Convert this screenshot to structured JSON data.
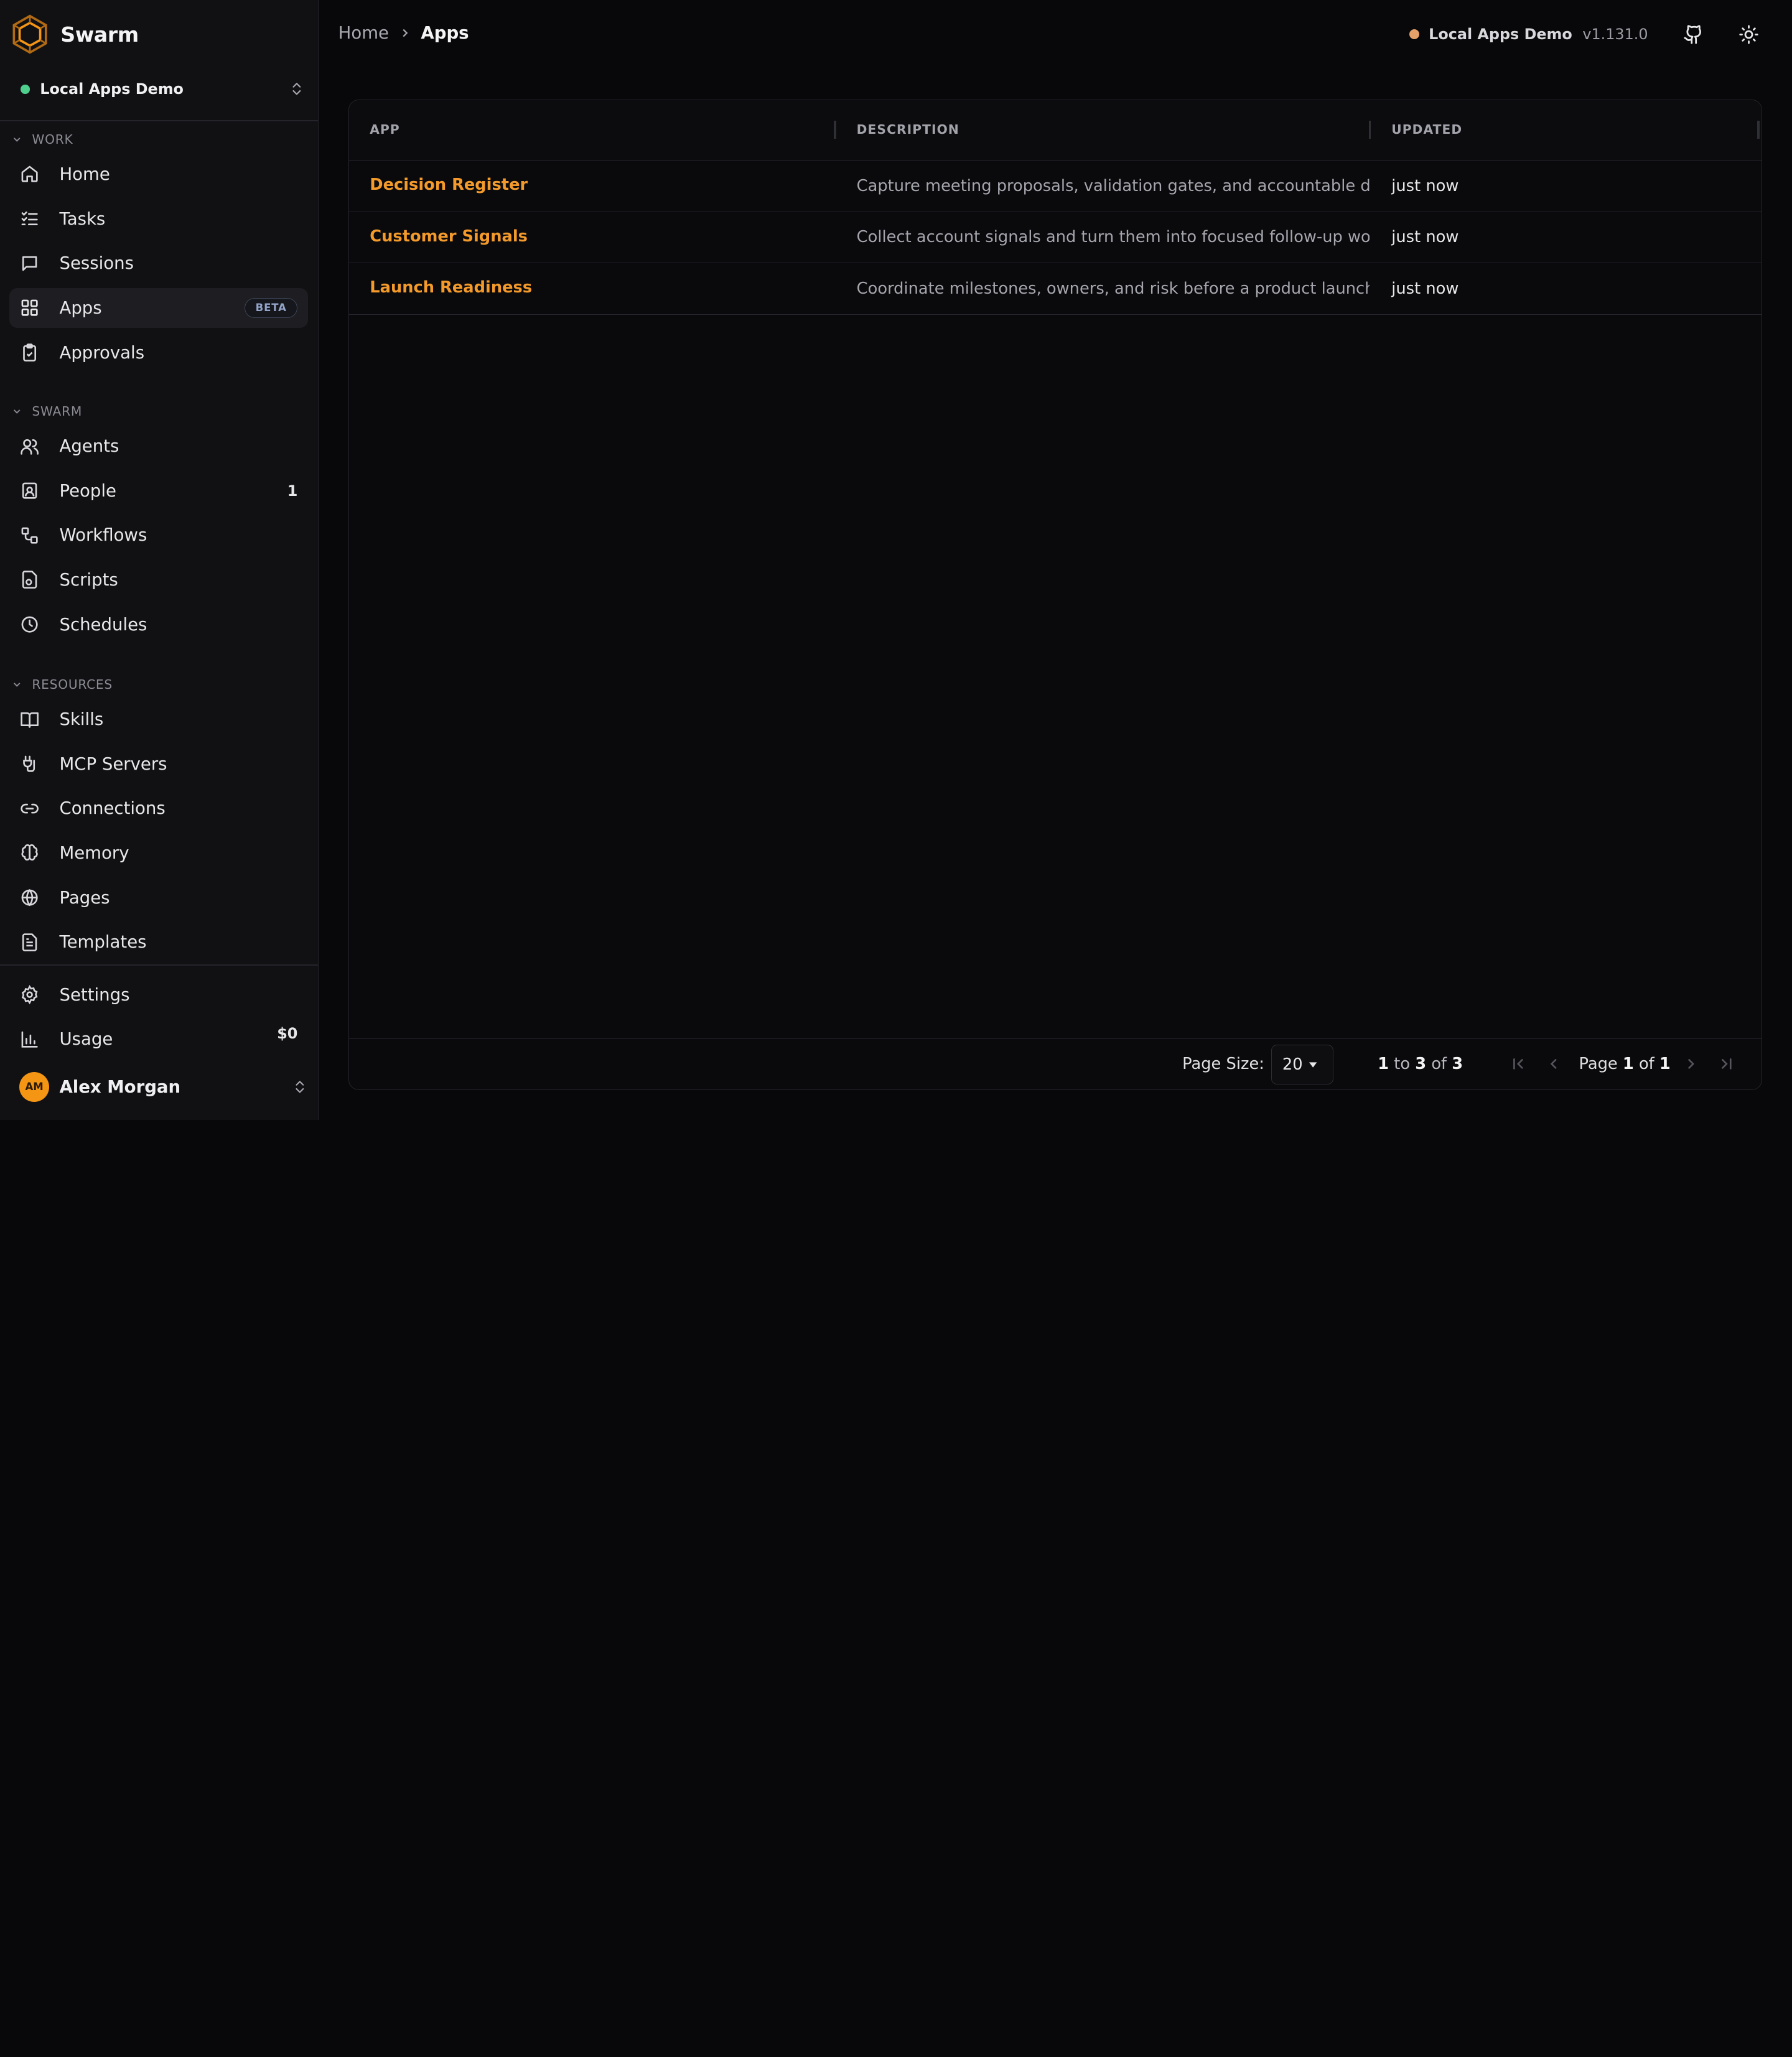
{
  "brand": {
    "name": "Swarm",
    "accent": "#f59514"
  },
  "workspace": {
    "name": "Local Apps Demo"
  },
  "sections": {
    "work": "WORK",
    "swarm": "SWARM",
    "resources": "RESOURCES"
  },
  "nav": {
    "home": "Home",
    "tasks": "Tasks",
    "sessions": "Sessions",
    "apps": "Apps",
    "apps_badge": "BETA",
    "approvals": "Approvals",
    "agents": "Agents",
    "people": "People",
    "people_count": "1",
    "workflows": "Workflows",
    "scripts": "Scripts",
    "schedules": "Schedules",
    "skills": "Skills",
    "mcp_servers": "MCP Servers",
    "connections": "Connections",
    "memory": "Memory",
    "pages": "Pages",
    "templates": "Templates",
    "settings": "Settings",
    "usage": "Usage",
    "usage_value": "$0"
  },
  "user": {
    "initials": "AM",
    "name": "Alex Morgan"
  },
  "breadcrumb": {
    "home": "Home",
    "current": "Apps"
  },
  "topbar": {
    "env": "Local Apps Demo",
    "version": "v1.131.0"
  },
  "table": {
    "headers": {
      "app": "APP",
      "description": "DESCRIPTION",
      "updated": "UPDATED"
    },
    "rows": [
      {
        "app": "Decision Register",
        "description": "Capture meeting proposals, validation gates, and accountable decisions",
        "updated": "just now"
      },
      {
        "app": "Customer Signals",
        "description": "Collect account signals and turn them into focused follow-up work",
        "updated": "just now"
      },
      {
        "app": "Launch Readiness",
        "description": "Coordinate milestones, owners, and risk before a product launch",
        "updated": "just now"
      }
    ]
  },
  "pagination": {
    "page_size_label": "Page Size:",
    "page_size": "20",
    "range_from": "1",
    "range_to_word": "to",
    "range_to": "3",
    "of_word": "of",
    "total": "3",
    "page_word": "Page",
    "page": "1",
    "pages": "1"
  }
}
